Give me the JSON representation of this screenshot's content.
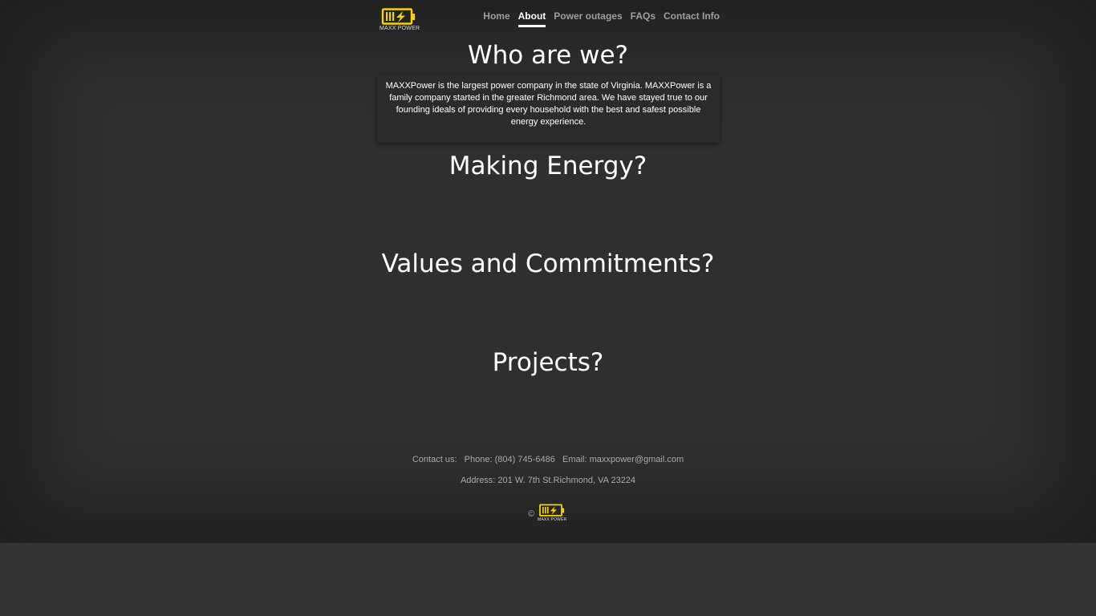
{
  "header": {
    "logo_text": "MAXX POWER",
    "nav": {
      "home": "Home",
      "about": "About",
      "power_outages": "Power outages",
      "faqs": "FAQs",
      "contact_info": "Contact Info"
    },
    "active_tab": "About"
  },
  "main": {
    "who_heading": "Who are we?",
    "who_text": "MAXXPower is the largest power company in the state of Virginia. MAXXPower is a family company started in the greater Richmond area. We have stayed true to our founding ideals of providing every household with the best and safest possible energy experience.",
    "energy_heading": "Making Energy?",
    "values_heading": "Values and Commitments?",
    "projects_heading": "Projects?"
  },
  "footer": {
    "contact_line": "Contact us:   Phone: (804) 745-6486   Email: maxxpower@gmail.com",
    "address_line": "Address: 201 W. 7th St.Richmond, VA 23224",
    "copyright": "©",
    "logo_text": "MAXX POWER"
  },
  "colors": {
    "brand_yellow": "#f5d20a",
    "background": "#2f2f2f",
    "text": "#ffffff",
    "nav_inactive": "#9e9e9e"
  },
  "icons": {
    "logo": "battery-bolt-icon"
  }
}
